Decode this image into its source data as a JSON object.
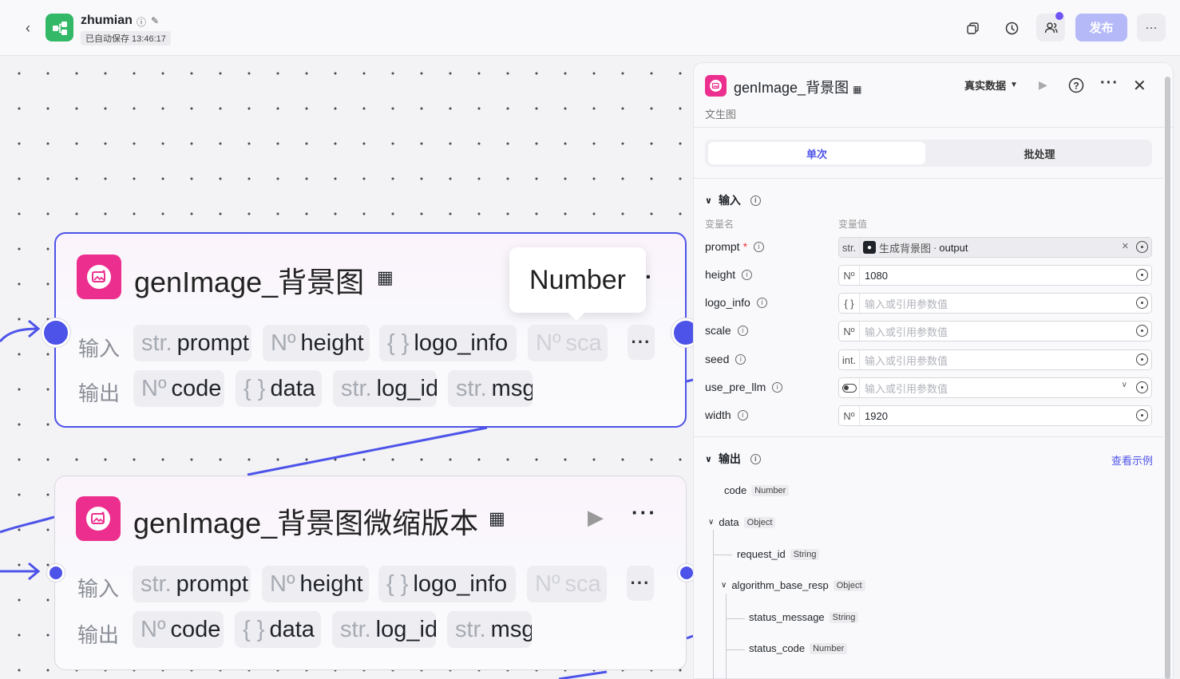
{
  "topbar": {
    "app_name": "zhumian",
    "autosave": "已自动保存 13:46:17",
    "publish_label": "发布"
  },
  "canvas": {
    "tooltip": "Number",
    "nodes": [
      {
        "title": "genImage_背景图",
        "input_label": "输入",
        "output_label": "输出",
        "inputs": [
          {
            "type": "str.",
            "name": "prompt"
          },
          {
            "type": "Nº",
            "name": "height"
          },
          {
            "type": "{ }",
            "name": "logo_info"
          },
          {
            "type": "Nº",
            "name": "sca"
          }
        ],
        "outputs": [
          {
            "type": "Nº",
            "name": "code"
          },
          {
            "type": "{ }",
            "name": "data"
          },
          {
            "type": "str.",
            "name": "log_id"
          },
          {
            "type": "str.",
            "name": "msg"
          }
        ]
      },
      {
        "title": "genImage_背景图微缩版本",
        "input_label": "输入",
        "output_label": "输出",
        "inputs": [
          {
            "type": "str.",
            "name": "prompt"
          },
          {
            "type": "Nº",
            "name": "height"
          },
          {
            "type": "{ }",
            "name": "logo_info"
          },
          {
            "type": "Nº",
            "name": "sca"
          }
        ],
        "outputs": [
          {
            "type": "Nº",
            "name": "code"
          },
          {
            "type": "{ }",
            "name": "data"
          },
          {
            "type": "str.",
            "name": "log_id"
          },
          {
            "type": "str.",
            "name": "msg"
          }
        ]
      }
    ]
  },
  "panel": {
    "title": "genImage_背景图",
    "subtitle": "文生图",
    "data_mode": "真实数据",
    "tabs": [
      "单次",
      "批处理"
    ],
    "input_section": "输入",
    "col_name": "变量名",
    "col_value": "变量值",
    "params": [
      {
        "name": "prompt",
        "required": true,
        "tag": "str.",
        "ref_node": "生成背景图",
        "ref_field": "output"
      },
      {
        "name": "height",
        "tag": "Nº",
        "value": "1080"
      },
      {
        "name": "logo_info",
        "tag": "{ }",
        "placeholder": "输入或引用参数值"
      },
      {
        "name": "scale",
        "tag": "Nº",
        "placeholder": "输入或引用参数值"
      },
      {
        "name": "seed",
        "tag": "int.",
        "placeholder": "输入或引用参数值"
      },
      {
        "name": "use_pre_llm",
        "tag": "toggle",
        "placeholder": "输入或引用参数值"
      },
      {
        "name": "width",
        "tag": "Nº",
        "value": "1920"
      }
    ],
    "output_section": "输出",
    "view_example": "查看示例",
    "outputs": [
      {
        "name": "code",
        "type": "Number"
      },
      {
        "name": "data",
        "type": "Object"
      },
      {
        "name": "request_id",
        "type": "String"
      },
      {
        "name": "algorithm_base_resp",
        "type": "Object"
      },
      {
        "name": "status_message",
        "type": "String"
      },
      {
        "name": "status_code",
        "type": "Number"
      }
    ]
  }
}
